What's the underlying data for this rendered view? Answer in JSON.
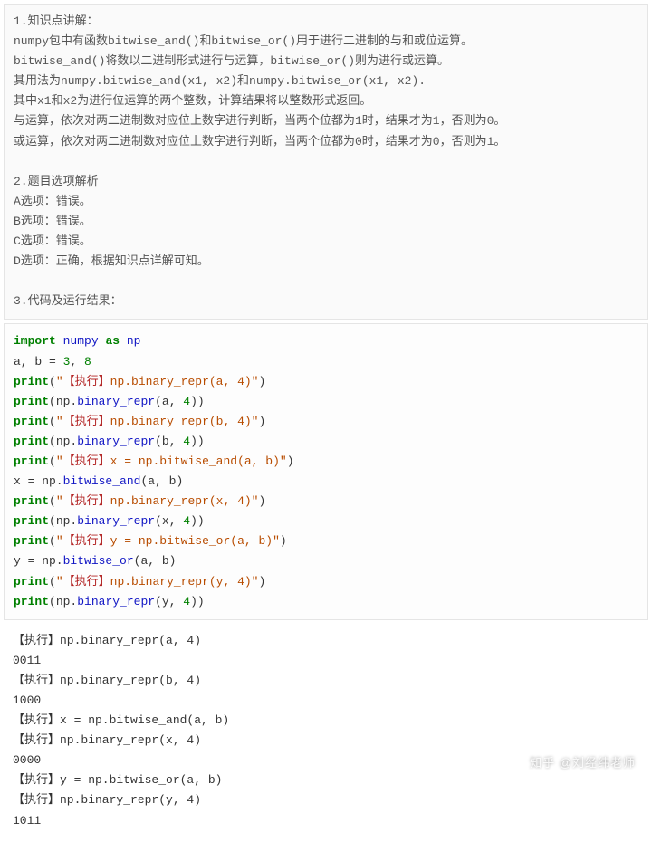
{
  "explain": {
    "h1": "1.知识点讲解：",
    "l1": "numpy包中有函数bitwise_and()和bitwise_or()用于进行二进制的与和或位运算。",
    "l2": "bitwise_and()将数以二进制形式进行与运算，bitwise_or()则为进行或运算。",
    "l3": "其用法为numpy.bitwise_and(x1, x2)和numpy.bitwise_or(x1, x2).",
    "l4": "其中x1和x2为进行位运算的两个整数，计算结果将以整数形式返回。",
    "l5": "与运算，依次对两二进制数对应位上数字进行判断，当两个位都为1时，结果才为1，否则为0。",
    "l6": "或运算，依次对两二进制数对应位上数字进行判断，当两个位都为0时，结果才为0，否则为1。",
    "h2": "2.题目选项解析",
    "oa": "A选项：错误。",
    "ob": "B选项：错误。",
    "oc": "C选项：错误。",
    "od": "D选项：正确，根据知识点详解可知。",
    "h3": "3.代码及运行结果："
  },
  "code": {
    "t_import": "import",
    "t_numpy": "numpy",
    "t_as": "as",
    "t_np": "np",
    "assign": "a, b = ",
    "v3": "3",
    "v8": "8",
    "v4": "4",
    "comma": ", ",
    "print": "print",
    "npdot": "np.",
    "binary_repr": "binary_repr",
    "bitwise_and": "bitwise_and",
    "bitwise_or": "bitwise_or",
    "s1a": "\"",
    "s1b": "【执行】",
    "s1c": "np.binary_repr(a, 4)\"",
    "s2c": "np.binary_repr(b, 4)\"",
    "s3c": "x = np.bitwise_and(a, b)\"",
    "s4c": "np.binary_repr(x, 4)\"",
    "s5c": "y = np.bitwise_or(a, b)\"",
    "s6c": "np.binary_repr(y, 4)\"",
    "x_eq": "x = np.",
    "y_eq": "y = np.",
    "a": "a",
    "b": "b",
    "x": "x",
    "y": "y",
    "lp": "(",
    "rp": ")"
  },
  "out": {
    "l1": "【执行】np.binary_repr(a, 4)",
    "l2": "0011",
    "l3": "【执行】np.binary_repr(b, 4)",
    "l4": "1000",
    "l5": "【执行】x = np.bitwise_and(a, b)",
    "l6": "【执行】np.binary_repr(x, 4)",
    "l7": "0000",
    "l8": "【执行】y = np.bitwise_or(a, b)",
    "l9": "【执行】np.binary_repr(y, 4)",
    "l10": "1011"
  },
  "watermark": "知乎 @刘经纬老师"
}
